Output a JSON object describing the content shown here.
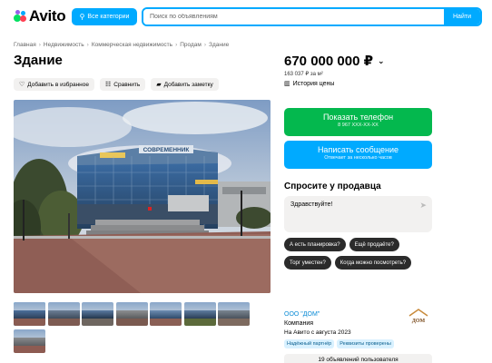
{
  "header": {
    "logo_text": "Avito",
    "categories_label": "Все категории",
    "search_placeholder": "Поиск по объявлениям",
    "search_button": "Найти",
    "colors": {
      "accent": "#00aaff",
      "green": "#04b84e"
    }
  },
  "breadcrumb": [
    "Главная",
    "Недвижимость",
    "Коммерческая недвижимость",
    "Продам",
    "Здание"
  ],
  "title": "Здание",
  "actions": [
    {
      "label": "Добавить в избранное",
      "icon": "heart-icon"
    },
    {
      "label": "Сравнить",
      "icon": "compare-icon"
    },
    {
      "label": "Добавить заметку",
      "icon": "note-icon"
    }
  ],
  "photo": {
    "sign_text": "СОВРЕМЕННИК",
    "thumb_count": 8
  },
  "price": {
    "value": "670 000 000 ₽",
    "per_sqm": "163 037 ₽ за м²",
    "history_label": "История цены"
  },
  "contact": {
    "phone_label": "Показать телефон",
    "phone_masked": "8 967 XXX-XX-XX",
    "message_label": "Написать сообщение",
    "message_sub": "Отвечает за несколько часов"
  },
  "ask": {
    "title": "Спросите у продавца",
    "message_value": "Здравствуйте!",
    "chips": [
      "А есть планировка?",
      "Ещё продаёте?",
      "Торг уместен?",
      "Когда можно посмотреть?"
    ]
  },
  "seller": {
    "name": "ООО \"ДОМ\"",
    "type": "Компания",
    "since": "На Авито с августа 2023",
    "logo_text": "ДОМ",
    "badges": [
      "Надёжный партнёр",
      "Реквизиты проверены"
    ],
    "ads_count_label": "19 объявлений пользователя"
  }
}
